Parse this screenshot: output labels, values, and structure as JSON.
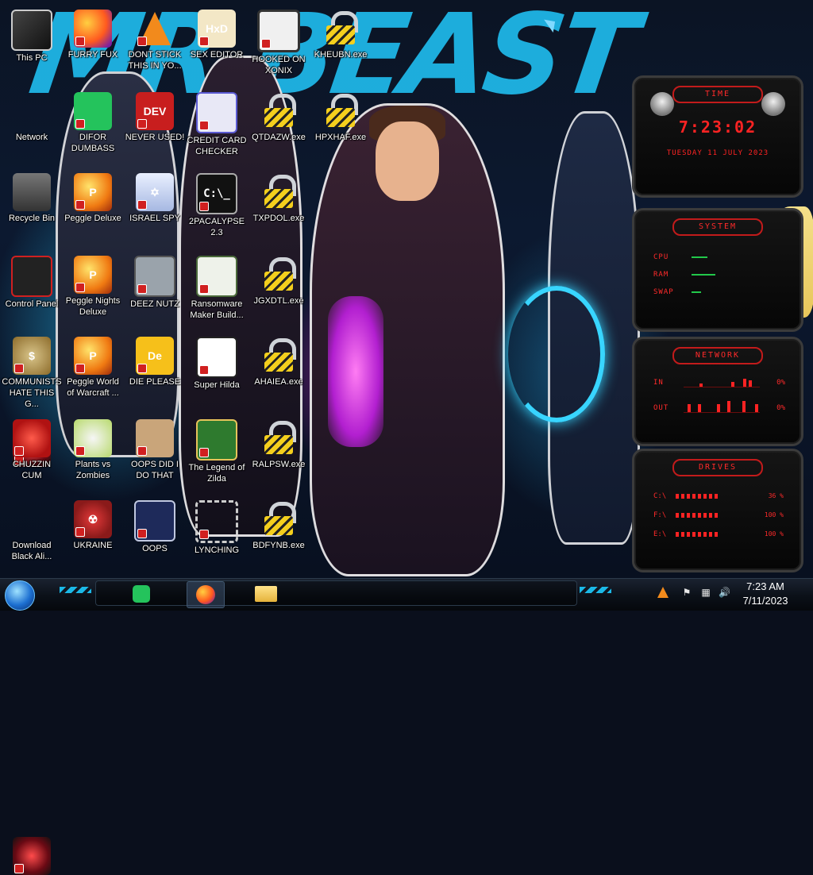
{
  "desktop": {
    "icons": [
      {
        "label": "This PC",
        "icon": "computer-icon"
      },
      {
        "label": "FURRY FUX",
        "icon": "firefox-icon"
      },
      {
        "label": "DONT STICK THIS IN YO...",
        "icon": "vlc-cone-icon"
      },
      {
        "label": "SEX EDITOR",
        "icon": "hxd-editor-icon"
      },
      {
        "label": "HOOKED ON XONIX",
        "icon": "xonix-game-icon"
      },
      {
        "label": "KHEUBN.exe",
        "icon": "padlock-icon"
      },
      {
        "label": "Network",
        "icon": "network-icon"
      },
      {
        "label": "DIFOR DUMBASS",
        "icon": "discord-green-icon"
      },
      {
        "label": "NEVER USED!",
        "icon": "dev-cpp-icon"
      },
      {
        "label": "CREDIT CARD CHECKER",
        "icon": "credit-card-icon"
      },
      {
        "label": "QTDAZW.exe",
        "icon": "padlock-icon"
      },
      {
        "label": "HPXHAF.exe",
        "icon": "padlock-icon"
      },
      {
        "label": "Recycle Bin",
        "icon": "recycle-bin-icon"
      },
      {
        "label": "Peggle Deluxe",
        "icon": "peggle-icon"
      },
      {
        "label": "ISRAEL SPY",
        "icon": "spy-app-icon"
      },
      {
        "label": "2PACALYPSE 2.3",
        "icon": "terminal-icon"
      },
      {
        "label": "TXPDOL.exe",
        "icon": "padlock-icon"
      },
      {
        "label": "Control Panel",
        "icon": "control-panel-icon"
      },
      {
        "label": "Peggle Nights Deluxe",
        "icon": "peggle-icon"
      },
      {
        "label": "DEEZ NUTZ",
        "icon": "stacked-windows-icon"
      },
      {
        "label": "Ransomware Maker Build...",
        "icon": "ransomware-app-icon"
      },
      {
        "label": "JGXDTL.exe",
        "icon": "padlock-icon"
      },
      {
        "label": "COMMUNISTS HATE THIS G...",
        "icon": "money-bag-icon"
      },
      {
        "label": "Peggle World of Warcraft ...",
        "icon": "peggle-icon"
      },
      {
        "label": "DIE PLEASE",
        "icon": "de-app-icon"
      },
      {
        "label": "Super Hilda",
        "icon": "pixel-cat-icon"
      },
      {
        "label": "AHAIEA.exe",
        "icon": "padlock-icon"
      },
      {
        "label": "CHUZZIN CUM",
        "icon": "chuzzle-icon"
      },
      {
        "label": "Plants vs Zombies",
        "icon": "pvz-icon"
      },
      {
        "label": "OOPS DID I DO THAT",
        "icon": "portrait-icon"
      },
      {
        "label": "The Legend of Zilda",
        "icon": "zelda-sprite-icon"
      },
      {
        "label": "RALPSW.exe",
        "icon": "padlock-icon"
      },
      {
        "label": "Download Black Ali...",
        "icon": "network-icon"
      },
      {
        "label": "UKRAINE",
        "icon": "radiation-icon"
      },
      {
        "label": "OOPS",
        "icon": "oops-app-icon"
      },
      {
        "label": "LYNCHING",
        "icon": "rope-icon"
      },
      {
        "label": "BDFYNB.exe",
        "icon": "padlock-icon"
      }
    ]
  },
  "wallpaper": {
    "title": "MR BEAST"
  },
  "gadgets": {
    "time": {
      "title": "TIME",
      "clock": "7:23:02",
      "date": "TUESDAY 11 JULY 2023"
    },
    "system": {
      "title": "SYSTEM",
      "meters": [
        {
          "label": "CPU",
          "value": ""
        },
        {
          "label": "RAM",
          "value": ""
        },
        {
          "label": "SWAP",
          "value": ""
        }
      ]
    },
    "network": {
      "title": "NETWORK",
      "rows": [
        {
          "label": "IN",
          "value": "0%"
        },
        {
          "label": "OUT",
          "value": "0%"
        }
      ]
    },
    "drives": {
      "title": "DRIVES",
      "rows": [
        {
          "label": "C:\\",
          "value": "36 %"
        },
        {
          "label": "F:\\",
          "value": "100 %"
        },
        {
          "label": "E:\\",
          "value": "100 %"
        }
      ]
    }
  },
  "taskbar": {
    "pinned": [
      {
        "icon": "discord-green-icon"
      },
      {
        "icon": "firefox-icon",
        "active": true
      },
      {
        "icon": "file-explorer-icon"
      }
    ],
    "tray": [
      "vlc-tray-icon",
      "flag-icon",
      "network-tray-icon",
      "volume-icon"
    ],
    "time": "7:23 AM",
    "date": "7/11/2023"
  },
  "colors": {
    "accent_cyan": "#1fb6e6",
    "gadget_red": "#ff2323",
    "lock_yellow": "#f4cf1d"
  }
}
